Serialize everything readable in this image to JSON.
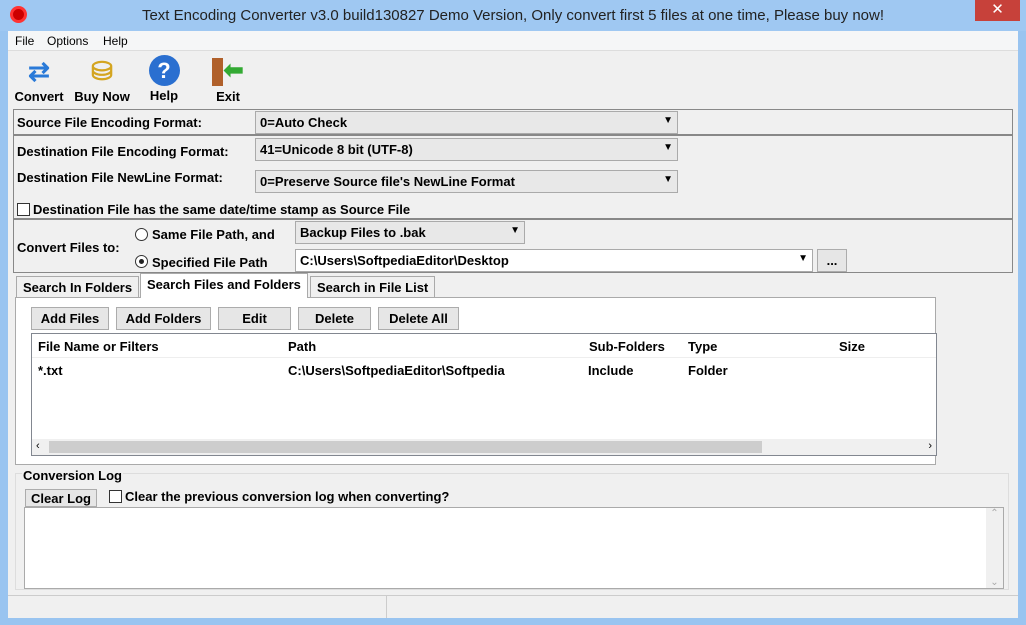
{
  "window": {
    "title": "Text Encoding Converter v3.0 build130827 Demo Version, Only convert first 5 files at one time, Please buy now!",
    "close": "✕"
  },
  "menu": [
    "File",
    "Options",
    "Help"
  ],
  "toolbar": [
    {
      "label": "Convert",
      "icon": "convert-arrows-icon"
    },
    {
      "label": "Buy Now",
      "icon": "coins-icon"
    },
    {
      "label": "Help",
      "icon": "help-icon"
    },
    {
      "label": "Exit",
      "icon": "exit-door-icon"
    }
  ],
  "source": {
    "label": "Source File Encoding Format:",
    "value": "0=Auto Check"
  },
  "dest": {
    "label": "Destination File Encoding Format:",
    "value": "41=Unicode 8 bit (UTF-8)",
    "newline_label": "Destination File NewLine Format:",
    "newline_value": "0=Preserve Source file's NewLine Format",
    "timestamp_label": "Destination File has the same date/time stamp as Source File",
    "timestamp_checked": false
  },
  "convert_to": {
    "label": "Convert Files to:",
    "same_path": "Same File Path, and",
    "backup": "Backup Files to .bak",
    "specified": "Specified File Path",
    "path": "C:\\Users\\SoftpediaEditor\\Desktop",
    "browse": "...",
    "selected": "Specified File Path"
  },
  "tabs": [
    {
      "label": "Search In Folders"
    },
    {
      "label": "Search Files and Folders",
      "active": true
    },
    {
      "label": "Search in File List"
    }
  ],
  "buttons": [
    "Add Files",
    "Add Folders",
    "Edit",
    "Delete",
    "Delete All"
  ],
  "table": {
    "columns": [
      "File Name or Filters",
      "Path",
      "Sub-Folders",
      "Type",
      "Size"
    ],
    "rows": [
      [
        "*.txt",
        "C:\\Users\\SoftpediaEditor\\Softpedia",
        "Include",
        "Folder",
        ""
      ]
    ]
  },
  "log": {
    "title": "Conversion Log",
    "clear": "Clear Log",
    "clear_option": "Clear the previous conversion log when converting?",
    "clear_option_checked": false,
    "content": ""
  }
}
